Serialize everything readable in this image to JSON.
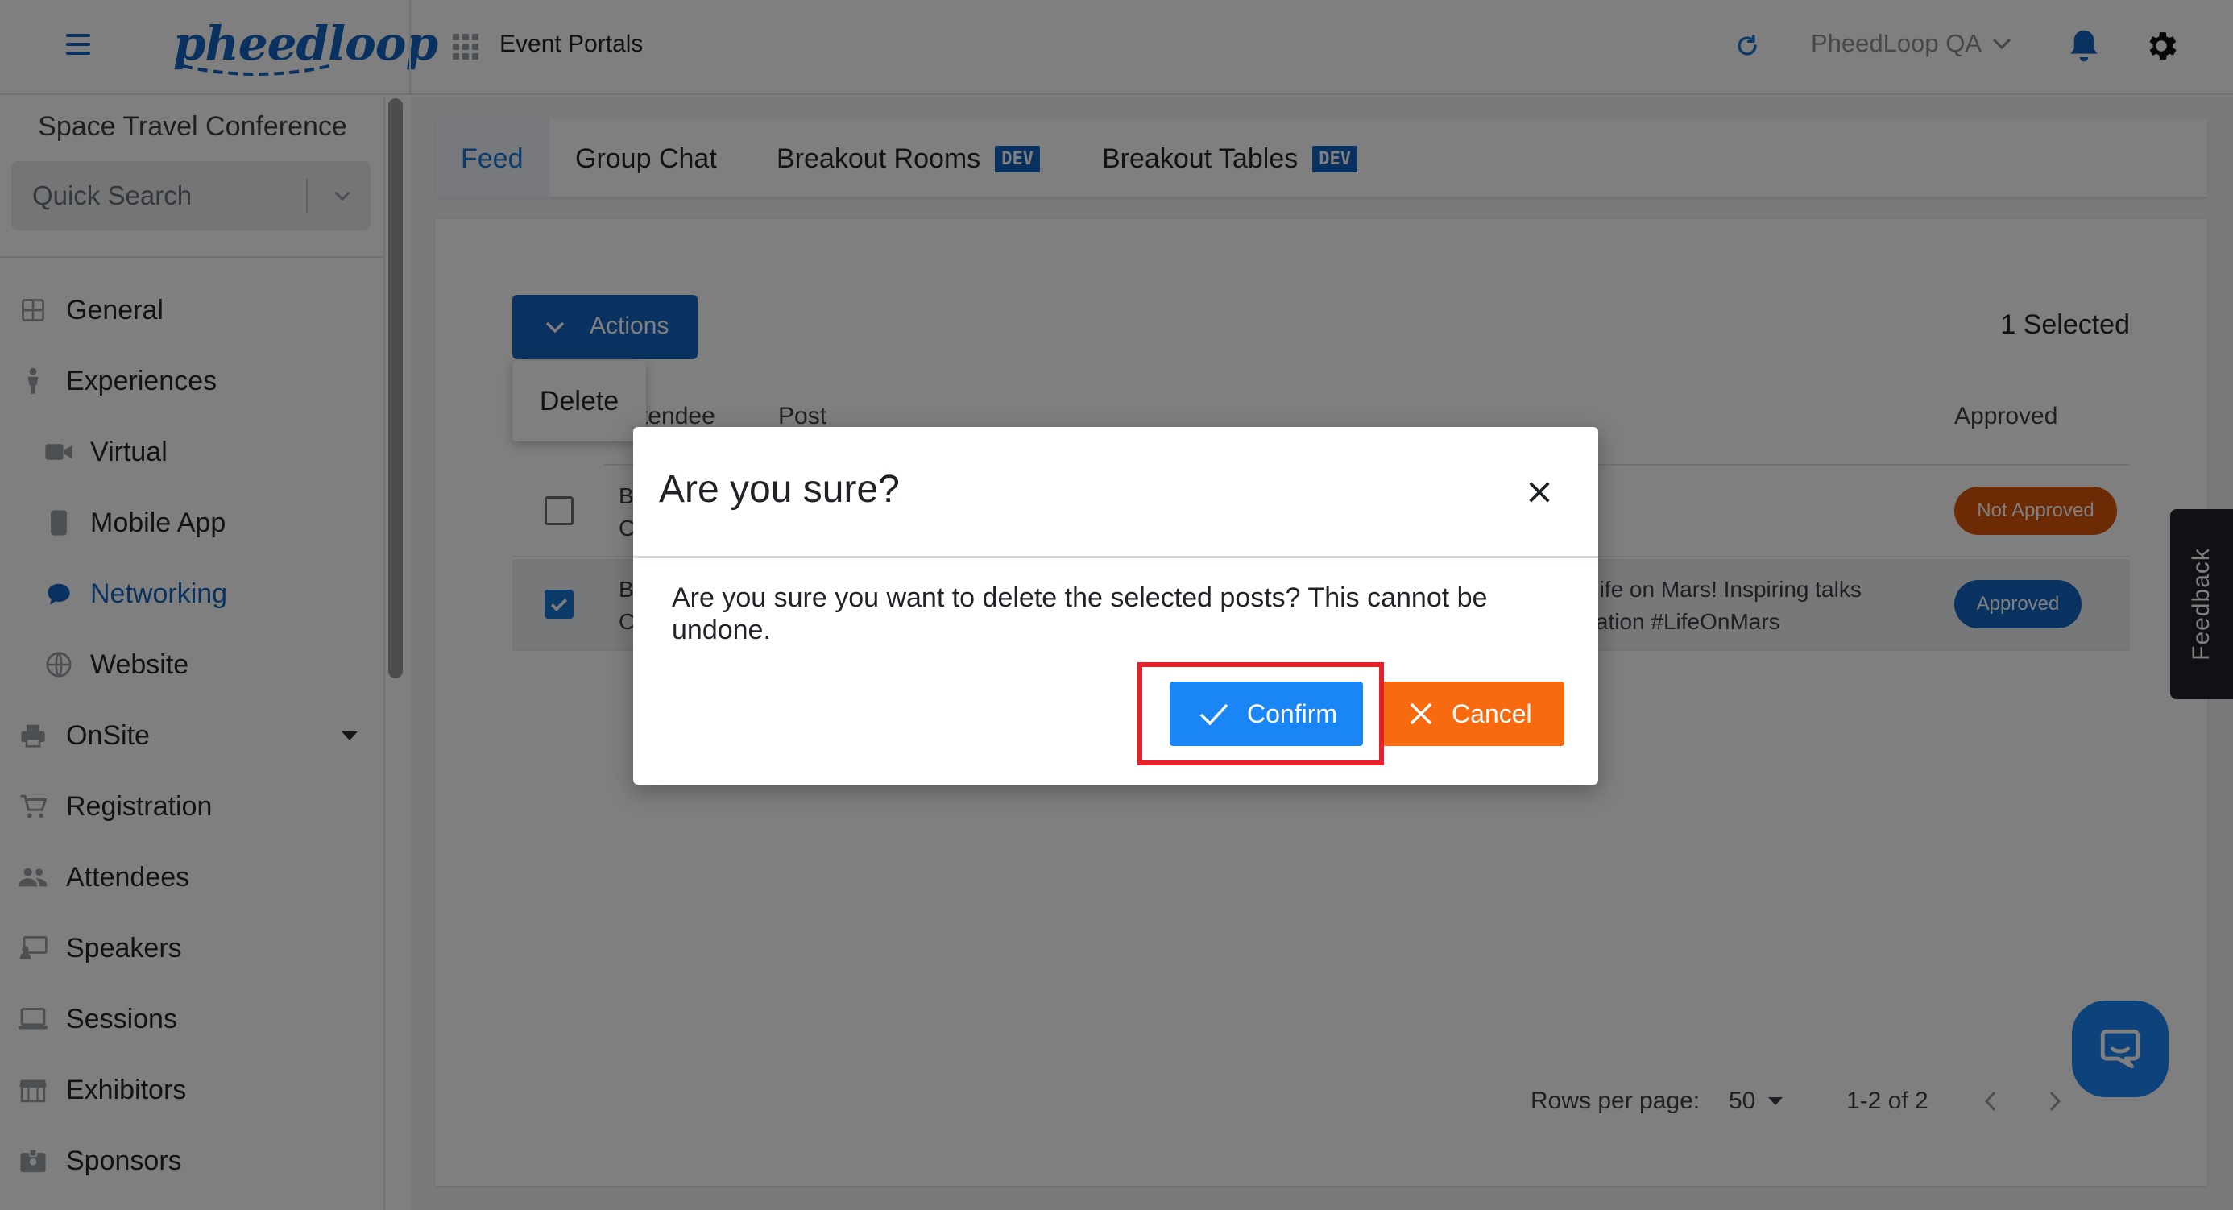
{
  "topbar": {
    "logo_text": "pheedloop",
    "section_title": "Event Portals",
    "account_name": "PheedLoop QA"
  },
  "sidebar": {
    "event_name": "Space Travel Conference",
    "search_placeholder": "Quick Search",
    "items": [
      {
        "label": "General",
        "icon": "grid-icon",
        "active": false
      },
      {
        "label": "Experiences",
        "icon": "person-icon",
        "active": false
      },
      {
        "label": "Virtual",
        "icon": "video-camera-icon",
        "active": false
      },
      {
        "label": "Mobile App",
        "icon": "phone-icon",
        "active": false
      },
      {
        "label": "Networking",
        "icon": "chat-bubble-icon",
        "active": true
      },
      {
        "label": "Website",
        "icon": "globe-icon",
        "active": false
      },
      {
        "label": "OnSite",
        "icon": "printer-icon",
        "active": false,
        "expandable": true
      },
      {
        "label": "Registration",
        "icon": "cart-icon",
        "active": false
      },
      {
        "label": "Attendees",
        "icon": "people-icon",
        "active": false
      },
      {
        "label": "Speakers",
        "icon": "presenter-icon",
        "active": false
      },
      {
        "label": "Sessions",
        "icon": "laptop-icon",
        "active": false
      },
      {
        "label": "Exhibitors",
        "icon": "store-icon",
        "active": false
      },
      {
        "label": "Sponsors",
        "icon": "badge-icon",
        "active": false
      }
    ]
  },
  "tabs": [
    {
      "label": "Feed",
      "active": true,
      "badge": ""
    },
    {
      "label": "Group Chat",
      "active": false,
      "badge": ""
    },
    {
      "label": "Breakout Rooms",
      "active": false,
      "badge": "DEV"
    },
    {
      "label": "Breakout Tables",
      "active": false,
      "badge": "DEV"
    }
  ],
  "feed": {
    "actions_label": "Actions",
    "menu_delete": "Delete",
    "selected_count": "1 Selected",
    "columns": {
      "attendee": "Attendee",
      "attendee_visible": "tendee",
      "post": "Post",
      "approved": "Approved"
    },
    "rows": [
      {
        "checked": false,
        "attendee_line1": "B",
        "attendee_line2": "C",
        "post_line1": "",
        "post_line2": "",
        "status": "Not Approved",
        "status_color": "#d9560b"
      },
      {
        "checked": true,
        "attendee_line1": "B",
        "attendee_line2": "C",
        "post_line1": "d life on Mars! Inspiring talks",
        "post_line2": "oration #LifeOnMars",
        "status": "Approved",
        "status_color": "#1565c0"
      }
    ],
    "pagination": {
      "rows_per_page_label": "Rows per page:",
      "rows_per_page": "50",
      "range": "1-2 of 2"
    }
  },
  "feedback_label": "Feedback",
  "modal": {
    "title": "Are you sure?",
    "body": "Are you sure you want to delete the selected posts? This cannot be undone.",
    "confirm_label": "Confirm",
    "cancel_label": "Cancel"
  },
  "colors": {
    "brand": "#1565c0",
    "confirm": "#1a86f5",
    "cancel": "#f76a10",
    "highlight": "#e8202a"
  }
}
